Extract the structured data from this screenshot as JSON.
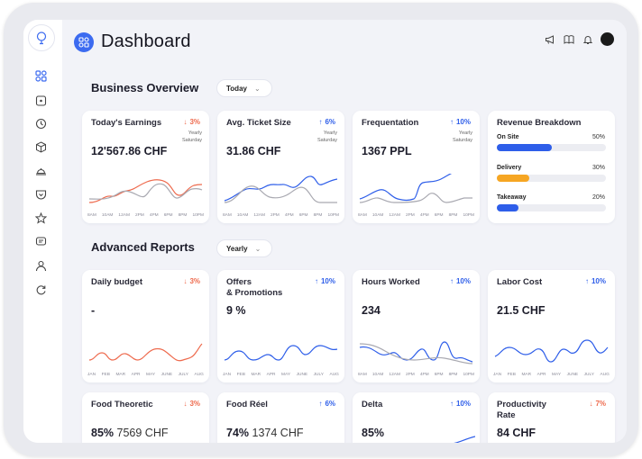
{
  "header": {
    "title": "Dashboard"
  },
  "sections": {
    "business": {
      "title": "Business Overview",
      "filter": "Today"
    },
    "advanced": {
      "title": "Advanced Reports",
      "filter": "Yearly"
    }
  },
  "colors": {
    "accent": "#2e5ee9",
    "negative": "#ee6a4d",
    "delivery": "#f6a623",
    "grey_line": "#a9a9b1"
  },
  "cards": {
    "earnings": {
      "title": "Today's Earnings",
      "trend": "3%",
      "direction": "down",
      "cmp1": "Yearly",
      "cmp2": "Saturday",
      "value": "12'567.86 CHF"
    },
    "ticket": {
      "title": "Avg. Ticket Size",
      "trend": "6%",
      "direction": "up",
      "cmp1": "Yearly",
      "cmp2": "Saturday",
      "value": "31.86 CHF"
    },
    "frequentation": {
      "title": "Frequentation",
      "trend": "10%",
      "direction": "up",
      "cmp1": "Yearly",
      "cmp2": "Saturday",
      "value": "1367 PPL"
    },
    "revenue": {
      "title": "Revenue Breakdown",
      "rows": [
        {
          "label": "On Site",
          "pct": "50%",
          "value": 0.5,
          "color": "#2e5ee9"
        },
        {
          "label": "Delivery",
          "pct": "30%",
          "value": 0.3,
          "color": "#f6a623"
        },
        {
          "label": "Takeaway",
          "pct": "20%",
          "value": 0.2,
          "color": "#2e5ee9"
        }
      ]
    },
    "budget": {
      "title": "Daily budget",
      "trend": "3%",
      "direction": "down",
      "value": "-"
    },
    "offers": {
      "title": "Offers",
      "title2": "& Promotions",
      "trend": "10%",
      "direction": "up",
      "value": "9 %"
    },
    "hours": {
      "title": "Hours Worked",
      "trend": "10%",
      "direction": "up",
      "value": "234"
    },
    "labor": {
      "title": "Labor Cost",
      "trend": "10%",
      "direction": "up",
      "value": "21.5 CHF"
    },
    "food_theoretic": {
      "title": "Food Theoretic",
      "trend": "3%",
      "direction": "down",
      "value_main": "85%",
      "value_sub": "7569 CHF"
    },
    "food_reel": {
      "title": "Food Réel",
      "trend": "6%",
      "direction": "up",
      "value_main": "74%",
      "value_sub": "1374 CHF"
    },
    "delta": {
      "title": "Delta",
      "trend": "10%",
      "direction": "up",
      "value": "85%"
    },
    "productivity": {
      "title": "Productivity",
      "title2": "Rate",
      "trend": "7%",
      "direction": "down",
      "value": "84 CHF"
    }
  },
  "axis": {
    "hours": [
      "8AM",
      "10AM",
      "12AM",
      "2PM",
      "4PM",
      "6PM",
      "8PM",
      "10PM"
    ],
    "months": [
      "JAN",
      "FEB",
      "MAR",
      "APR",
      "MAY",
      "JUNE",
      "JULY",
      "AUG"
    ]
  },
  "icons": {
    "sidebar": [
      "grid-icon",
      "calendar-icon",
      "clock-icon",
      "box-icon",
      "dish-icon",
      "pocket-icon",
      "star-icon",
      "chat-icon",
      "user-icon",
      "refresh-icon"
    ],
    "top": [
      "megaphone-icon",
      "book-icon",
      "bell-icon"
    ]
  }
}
